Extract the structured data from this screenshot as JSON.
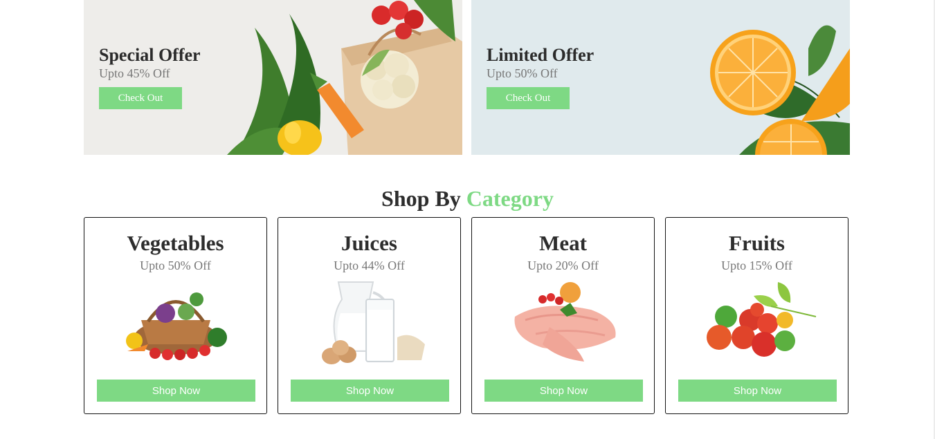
{
  "banners": [
    {
      "title": "Special Offer",
      "subtitle": "Upto 45% Off",
      "button": "Check Out",
      "art": "grocery-bag-illustration"
    },
    {
      "title": "Limited Offer",
      "subtitle": "Upto 50% Off",
      "button": "Check Out",
      "art": "orange-slices-illustration"
    }
  ],
  "section": {
    "title_main": "Shop By",
    "title_accent": "Category"
  },
  "categories": [
    {
      "name": "Vegetables",
      "discount": "Upto 50% Off",
      "button": "Shop Now",
      "image": "vegetable-basket-image"
    },
    {
      "name": "Juices",
      "discount": "Upto 44% Off",
      "button": "Shop Now",
      "image": "milk-jug-image"
    },
    {
      "name": "Meat",
      "discount": "Upto 20% Off",
      "button": "Shop Now",
      "image": "raw-meat-image"
    },
    {
      "name": "Fruits",
      "discount": "Upto 15% Off",
      "button": "Shop Now",
      "image": "fruit-bunch-image"
    }
  ],
  "colors": {
    "accent": "#7ed984",
    "heading": "#2d2d2d",
    "muted": "#777777"
  }
}
